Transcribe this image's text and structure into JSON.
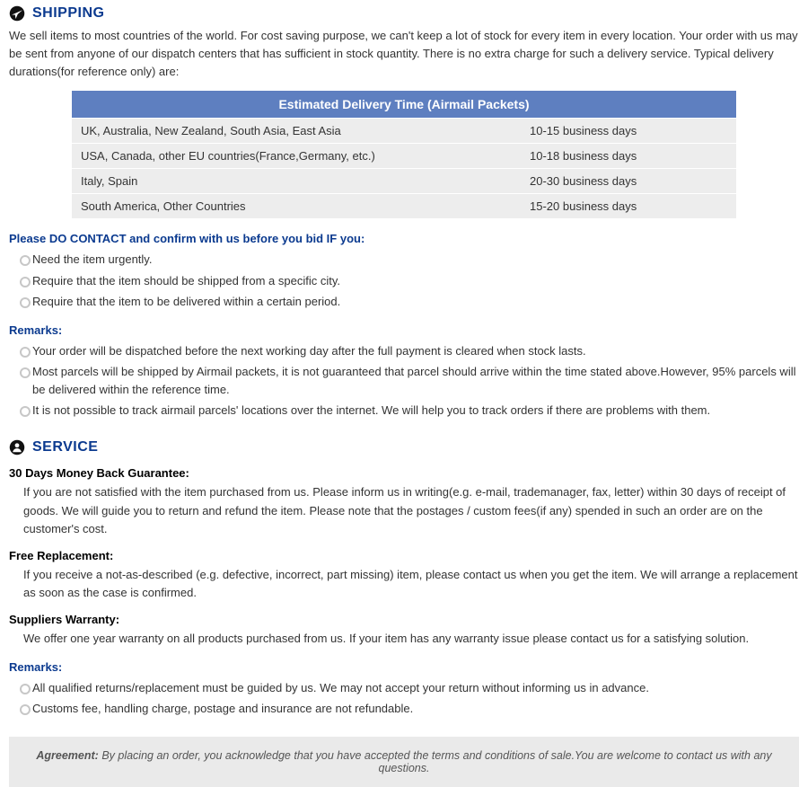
{
  "shipping": {
    "title": "SHIPPING",
    "intro": "We sell items to most countries of the world. For cost saving purpose, we can't keep a lot of stock for every item in every location. Your order with us may be sent from anyone of our dispatch centers that has sufficient in stock quantity. There is no extra charge for such a delivery service. Typical delivery durations(for reference only) are:",
    "table_header": "Estimated Delivery Time (Airmail Packets)",
    "rows": [
      {
        "region": "UK, Australia, New Zealand, South Asia, East Asia",
        "time": "10-15 business days"
      },
      {
        "region": "USA, Canada, other EU countries(France,Germany, etc.)",
        "time": "10-18 business days"
      },
      {
        "region": "Italy, Spain",
        "time": "20-30 business days"
      },
      {
        "region": "South America, Other Countries",
        "time": "15-20 business days"
      }
    ],
    "contact_heading": "Please DO CONTACT and confirm with us before you bid IF you:",
    "contact_items": [
      "Need the item urgently.",
      "Require that the item should be shipped from a specific city.",
      "Require that the item to be delivered within a certain period."
    ],
    "remarks_heading": "Remarks:",
    "remarks_items": [
      "Your order will be dispatched before the next working day after the full payment is cleared when stock lasts.",
      "Most parcels will be shipped by Airmail packets, it is not guaranteed that parcel should arrive within the time stated above.However, 95% parcels will be delivered within the reference time.",
      "It is not possible to track airmail parcels' locations over the internet. We will help you to track orders if there are problems with them."
    ]
  },
  "service": {
    "title": "SERVICE",
    "money_back_heading": "30 Days Money Back Guarantee:",
    "money_back_text": "If you are not satisfied with the item purchased from us. Please inform us in writing(e.g. e-mail, trademanager, fax, letter) within 30 days of receipt of goods. We will guide you to return and refund the item. Please note that the postages / custom fees(if any) spended in such an order are on the customer's cost.",
    "free_replacement_heading": "Free Replacement:",
    "free_replacement_text": "If you receive a not-as-described (e.g. defective, incorrect, part missing) item, please contact us when you get the item. We will arrange a replacement as soon as the case is confirmed.",
    "warranty_heading": "Suppliers Warranty:",
    "warranty_text": "We offer one year warranty on all products purchased from us. If your item has any warranty issue please contact us for a satisfying solution.",
    "remarks_heading": "Remarks:",
    "remarks_items": [
      "All qualified returns/replacement must be guided by us. We may not accept your return without informing us in advance.",
      "Customs fee, handling charge, postage and insurance are not refundable."
    ]
  },
  "agreement": {
    "lead": "Agreement:",
    "text": " By placing an order, you acknowledge that you have accepted the terms and conditions of sale.You are welcome to contact us with any questions."
  }
}
